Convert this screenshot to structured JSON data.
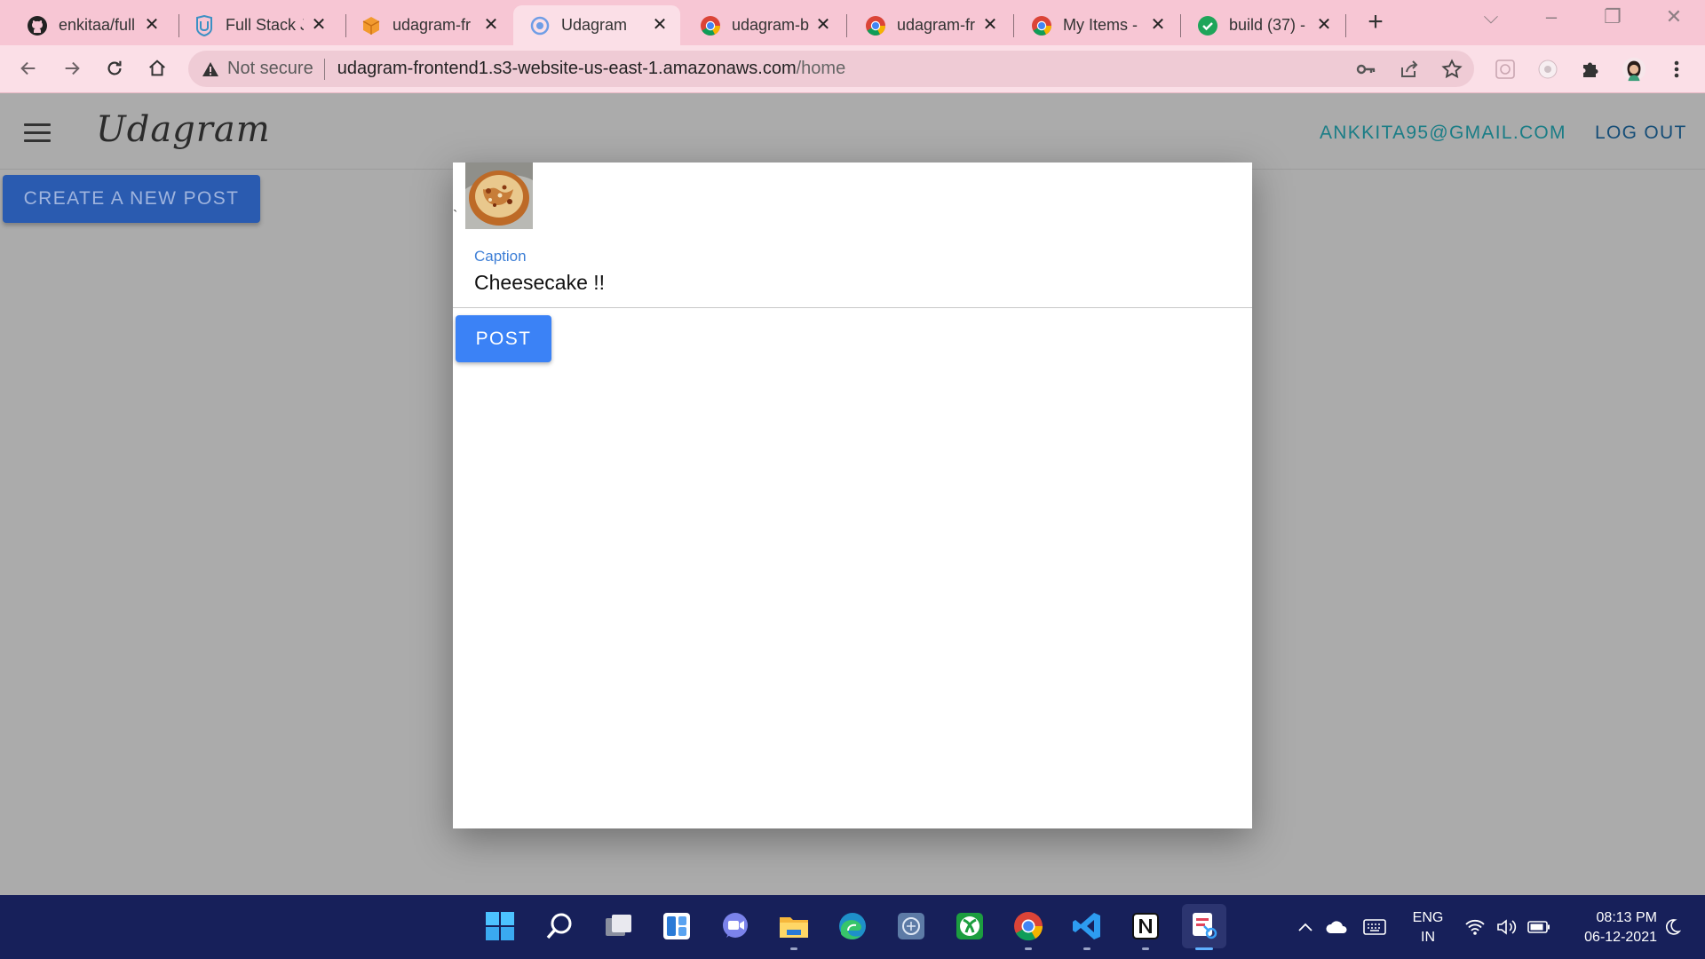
{
  "browser": {
    "tabs": [
      {
        "label": "enkitaa/full",
        "icon": "github-icon"
      },
      {
        "label": "Full Stack Ja",
        "icon": "udacity-icon"
      },
      {
        "label": "udagram-fr",
        "icon": "aws-s3-icon"
      },
      {
        "label": "Udagram",
        "icon": "loading-icon",
        "active": true
      },
      {
        "label": "udagram-b",
        "icon": "chrome-icon"
      },
      {
        "label": "udagram-fr",
        "icon": "chrome-icon"
      },
      {
        "label": "My Items -",
        "icon": "chrome-icon"
      },
      {
        "label": "build (37) -",
        "icon": "check-circle-icon"
      }
    ],
    "address": {
      "security": "Not secure",
      "host": "udagram-frontend1.s3-website-us-east-1.amazonaws.com",
      "path": "/home"
    }
  },
  "app": {
    "logo": "Udagram",
    "user_email": "ANKKITA95@GMAIL.COM",
    "logout": "LOG OUT",
    "create_post": "CREATE A NEW POST"
  },
  "modal": {
    "stray_char": "`",
    "caption_label": "Caption",
    "caption_value": "Cheesecake !!",
    "post_button": "POST"
  },
  "taskbar": {
    "lang_line1": "ENG",
    "lang_line2": "IN",
    "time": "08:13 PM",
    "date": "06-12-2021"
  },
  "colors": {
    "tab_strip": "#f7c6d4",
    "toolbar": "#fbdfe7",
    "overlay": "#ababab",
    "create_button": "#2a5bb0",
    "post_button": "#3b82f6",
    "caption_label": "#3e7fd6",
    "taskbar": "#17205a"
  }
}
